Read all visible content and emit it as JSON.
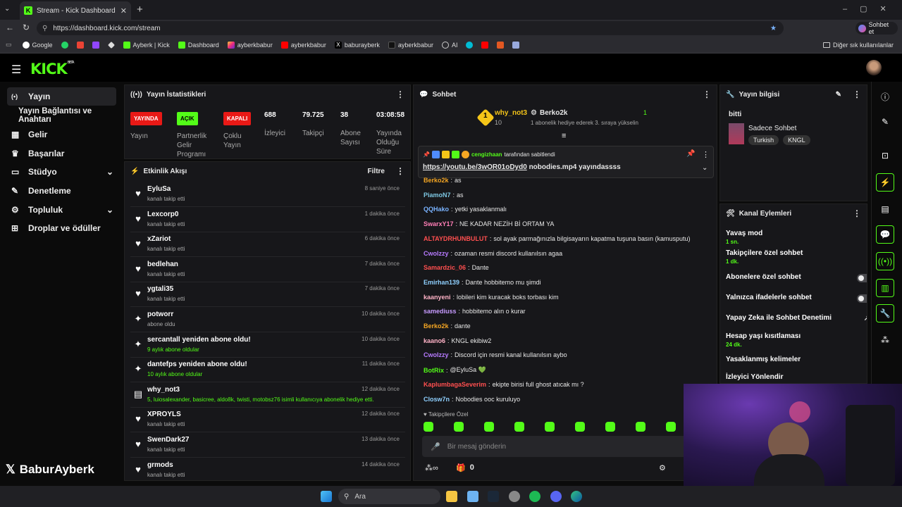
{
  "browser": {
    "tab_title": "Stream - Kick Dashboard",
    "url": "https://dashboard.kick.com/stream",
    "copilot_label": "Sohbet et",
    "bookmarks": [
      "Google",
      "",
      "",
      "",
      "",
      "Ayberk | Kick",
      "Dashboard",
      "ayberkbabur",
      "ayberkbabur",
      "baburayberk",
      "ayberkbabur",
      "AI",
      "",
      "",
      "",
      ""
    ],
    "other_bookmarks": "Diğer sık kullanılanlar"
  },
  "app": {
    "logo": "KICK",
    "logo_beta": "BETA"
  },
  "sidebar": {
    "items": [
      {
        "label": "Yayın",
        "icon": "(•)"
      },
      {
        "label": "Yayın Bağlantısı ve Anahtarı",
        "icon": ""
      },
      {
        "label": "Gelir",
        "icon": "▦"
      },
      {
        "label": "Başarılar",
        "icon": "♛"
      },
      {
        "label": "Stüdyo",
        "icon": "▭"
      },
      {
        "label": "Denetleme",
        "icon": "✎"
      },
      {
        "label": "Topluluk",
        "icon": "⚙"
      },
      {
        "label": "Droplar ve ödüller",
        "icon": "⊞"
      }
    ]
  },
  "watermark": "BaburAyberk",
  "stats": {
    "title": "Yayın İstatistikleri",
    "cols": [
      {
        "badge": "YAYINDA",
        "label": "Yayın"
      },
      {
        "badge": "AÇIK",
        "label": "Partnerlik Gelir Programı"
      },
      {
        "badge": "KAPALI",
        "label": "Çoklu Yayın"
      },
      {
        "value": "688",
        "label": "İzleyici"
      },
      {
        "value": "79.725",
        "label": "Takipçi"
      },
      {
        "value": "38",
        "label": "Abone Sayısı"
      },
      {
        "value": "03:08:58",
        "label": "Yayında Olduğu Süre"
      }
    ]
  },
  "activity": {
    "title": "Etkinlik Akışı",
    "filter": "Filtre",
    "events": [
      {
        "name": "EyluSa",
        "sub": "kanalı takip etti",
        "time": "8 saniye önce",
        "icon": "♥"
      },
      {
        "name": "Lexcorp0",
        "sub": "kanalı takip etti",
        "time": "1 dakika önce",
        "icon": "♥"
      },
      {
        "name": "xZariot",
        "sub": "kanalı takip etti",
        "time": "6 dakika önce",
        "icon": "♥"
      },
      {
        "name": "bedlehan",
        "sub": "kanalı takip etti",
        "time": "7 dakika önce",
        "icon": "♥"
      },
      {
        "name": "ygtali35",
        "sub": "kanalı takip etti",
        "time": "7 dakika önce",
        "icon": "♥"
      },
      {
        "name": "potworr",
        "sub": "abone oldu",
        "time": "10 dakika önce",
        "icon": "✦"
      },
      {
        "name": "sercantall yeniden abone oldu!",
        "sub": "9 aylık abone oldular",
        "time": "10 dakika önce",
        "icon": "✦"
      },
      {
        "name": "dantefps yeniden abone oldu!",
        "sub": "10 aylık abone oldular",
        "time": "11 dakika önce",
        "icon": "✦"
      },
      {
        "name": "why_not3",
        "sub": "5, luiosalexander, basicree, aldo8k, twisti, motobsz76 isimli kullanıcıya abonelik hediye etti.",
        "time": "12 dakika önce",
        "icon": "▤"
      },
      {
        "name": "XPROYLS",
        "sub": "kanalı takip etti",
        "time": "12 dakika önce",
        "icon": "♥"
      },
      {
        "name": "SwenDark27",
        "sub": "kanalı takip etti",
        "time": "13 dakika önce",
        "icon": "♥"
      },
      {
        "name": "grmods",
        "sub": "kanalı takip etti",
        "time": "14 dakika önce",
        "icon": "♥"
      }
    ]
  },
  "chat": {
    "title": "Sohbet",
    "gifter1": {
      "name": "why_not3",
      "count": "10",
      "rank": "1"
    },
    "gifter2": {
      "name": "Berko2k",
      "count": "1",
      "note": "1 abonelik hediye ederek 3. sıraya yükselin"
    },
    "pinned": {
      "by": "cengizhaan",
      "by_text": "tarafından sabitlendi",
      "link": "https://youtu.be/3wOR01oDyd0",
      "text": " nobodies.mp4 yayındassss"
    },
    "messages": [
      {
        "user": "Berko2k",
        "color": "#f5a623",
        "text": "as"
      },
      {
        "user": "PiamoN7",
        "color": "#7ec8e3",
        "text": "as"
      },
      {
        "user": "QQHako",
        "color": "#7ab3ff",
        "text": "yetki yasaklanmalı"
      },
      {
        "user": "SwarxY17",
        "color": "#ff7eb6",
        "text": "NE KADAR NEZİH Bİ ORTAM YA"
      },
      {
        "user": "ALTAYDRHUNBULUT",
        "color": "#ff4f4f",
        "text": "sol ayak parmağınızla bilgisayarın kapatma tuşuna basın (kamusputu)"
      },
      {
        "user": "Cwolzzy",
        "color": "#b77bff",
        "text": "ozaman resmi discord kullanılsın agaa"
      },
      {
        "user": "Samardzic_06",
        "color": "#ff4f4f",
        "text": "Dante"
      },
      {
        "user": "Emirhan139",
        "color": "#8fd0ff",
        "text": "Dante hobbitemo mu şimdi"
      },
      {
        "user": "kaanyeni",
        "color": "#ffb3c7",
        "text": "lobileri kim kuracak boks torbası kim"
      },
      {
        "user": "samediuss",
        "color": "#c79bff",
        "text": "hobbitemo alın o kurar"
      },
      {
        "user": "Berko2k",
        "color": "#f5a623",
        "text": "dante"
      },
      {
        "user": "kaano6",
        "color": "#ffb3c7",
        "text": "KNGL ekibiw2"
      },
      {
        "user": "Cwolzzy",
        "color": "#b77bff",
        "text": "Discord için resmi kanal kullanılsın aybo"
      },
      {
        "user": "BotRix",
        "color": "#53fc18",
        "text": "@EyluSa 💚"
      },
      {
        "user": "KaplumbagaSeverim",
        "color": "#ff4f4f",
        "text": "ekipte birisi full ghost atıcak mı ?"
      },
      {
        "user": "Closw7n",
        "color": "#8fd0ff",
        "text": "Nobodies ooc kuruluyo"
      }
    ],
    "followers_only": "Takipçilere Özel",
    "placeholder": "Bir mesaj gönderin",
    "points": "0"
  },
  "info": {
    "title": "Yayın bilgisi",
    "stream_title": "bitti",
    "category": "Sadece Sohbet",
    "tags": [
      "Turkish",
      "KNGL"
    ]
  },
  "channel_actions": {
    "title": "Kanal Eylemleri",
    "items": [
      {
        "label": "Yavaş mod",
        "value": "1 sn.",
        "ctrl": "chev"
      },
      {
        "label": "Takipçilere özel sohbet",
        "value": "1 dk.",
        "ctrl": "chev"
      },
      {
        "label": "Abonelere özel sohbet",
        "value": "",
        "ctrl": "toggle"
      },
      {
        "label": "Yalnızca ifadelerle sohbet",
        "value": "",
        "ctrl": "toggle"
      },
      {
        "label": "Yapay Zeka ile Sohbet Denetimi",
        "value": "",
        "ctrl": "ext"
      },
      {
        "label": "Hesap yaşı kısıtlaması",
        "value": "24 dk.",
        "ctrl": "chev"
      },
      {
        "label": "Yasaklanmış kelimeler",
        "value": "",
        "ctrl": "chev"
      },
      {
        "label": "İzleyici Yönlendir",
        "value": "",
        "ctrl": "none"
      }
    ]
  },
  "taskbar": {
    "search": "Ara"
  }
}
